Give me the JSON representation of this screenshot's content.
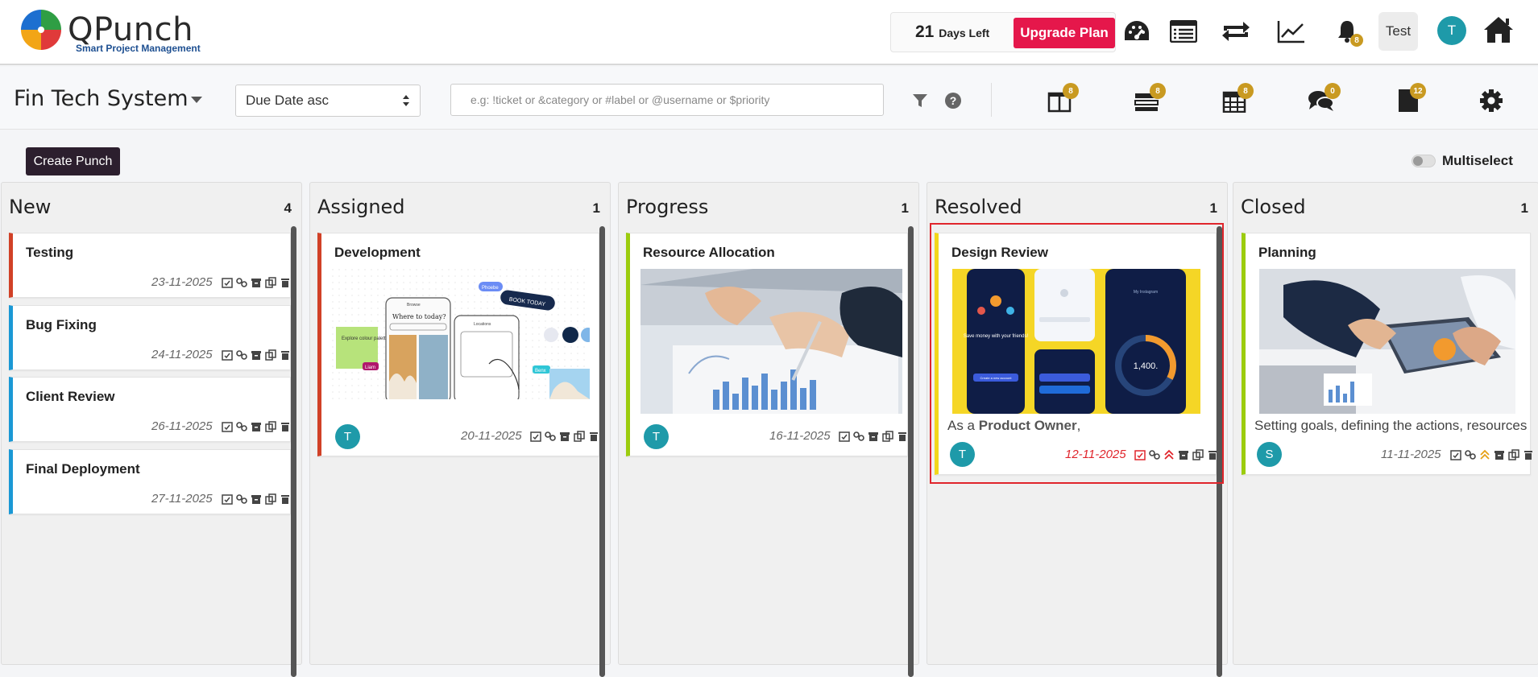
{
  "app": {
    "name": "QPunch",
    "tagline": "Smart Project Management"
  },
  "header": {
    "days_left_number": "21",
    "days_left_text": "Days Left",
    "upgrade_label": "Upgrade Plan",
    "notification_count": "8",
    "user_button_label": "Test",
    "avatar_initial": "T"
  },
  "toolbar": {
    "project_name": "Fin Tech System",
    "sort_value": "Due Date asc",
    "search_placeholder": "e.g: !ticket or &category or #label or @username or $priority",
    "badges": {
      "board": "8",
      "list": "8",
      "calendar": "8",
      "chat": "0",
      "docs": "12"
    }
  },
  "actions": {
    "create_label": "Create Punch",
    "multiselect_label": "Multiselect"
  },
  "columns": [
    {
      "title": "New",
      "count": "4",
      "cards": [
        {
          "title": "Testing",
          "date": "23-11-2025"
        },
        {
          "title": "Bug Fixing",
          "date": "24-11-2025"
        },
        {
          "title": "Client Review",
          "date": "26-11-2025"
        },
        {
          "title": "Final Deployment",
          "date": "27-11-2025"
        }
      ]
    },
    {
      "title": "Assigned",
      "count": "1",
      "cards": [
        {
          "title": "Development",
          "date": "20-11-2025",
          "assignee": "T",
          "image_text": {
            "a": "Explore colour palettes",
            "b": "Where to today?",
            "c": "BOOK TODAY",
            "d": "Phoebe",
            "e": "Liam",
            "f": "Benx",
            "g": "Browse",
            "h": "Locations"
          }
        }
      ]
    },
    {
      "title": "Progress",
      "count": "1",
      "cards": [
        {
          "title": "Resource Allocation",
          "date": "16-11-2025",
          "assignee": "T"
        }
      ]
    },
    {
      "title": "Resolved",
      "count": "1",
      "cards": [
        {
          "title": "Design Review",
          "date": "12-11-2025",
          "assignee": "T",
          "desc_prefix": "As a ",
          "desc_bold": "Product Owner",
          "desc_suffix": ",",
          "image_text": {
            "a": "Save money with your friends!",
            "b": "1,400.",
            "c": "Create a new account",
            "d": "My Instagram"
          }
        }
      ]
    },
    {
      "title": "Closed",
      "count": "1",
      "cards": [
        {
          "title": "Planning",
          "date": "11-11-2025",
          "assignee": "S",
          "desc": "Setting goals, defining the actions, resources,"
        }
      ]
    }
  ],
  "colors": {
    "accent": "#e5174b",
    "badge": "#c99a21",
    "avatar": "#1e9aa9",
    "stripe_red": "#d14127",
    "stripe_blue": "#1a98d5",
    "stripe_lime": "#9ccc0e",
    "stripe_yellow": "#f2d71a",
    "selection": "#e0252c",
    "overdue": "#e0252c"
  }
}
